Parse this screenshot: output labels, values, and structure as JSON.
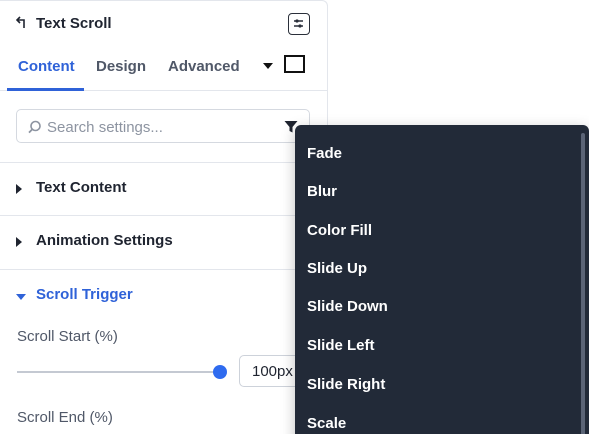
{
  "header": {
    "title": "Text Scroll",
    "back_icon": "back-arrow-icon",
    "options_icon": "settings-toggle-icon"
  },
  "tabs": [
    {
      "label": "Content",
      "active": true
    },
    {
      "label": "Design",
      "active": false
    },
    {
      "label": "Advanced",
      "active": false
    }
  ],
  "search": {
    "placeholder": "Search settings...",
    "value": ""
  },
  "sections": [
    {
      "label": "Text Content",
      "expanded": false
    },
    {
      "label": "Animation Settings",
      "expanded": false
    },
    {
      "label": "Scroll Trigger",
      "expanded": true
    }
  ],
  "scroll_trigger": {
    "start_label": "Scroll Start (%)",
    "start_value": "100px",
    "start_slider_level": 1.0,
    "end_label": "Scroll End (%)"
  },
  "dropdown": {
    "items": [
      "Fade",
      "Blur",
      "Color Fill",
      "Slide Up",
      "Slide Down",
      "Slide Left",
      "Slide Right",
      "Scale"
    ]
  },
  "colors": {
    "accent": "#2f62d8",
    "dropdown_bg": "#222a38",
    "slider_thumb": "#2f6bef"
  }
}
